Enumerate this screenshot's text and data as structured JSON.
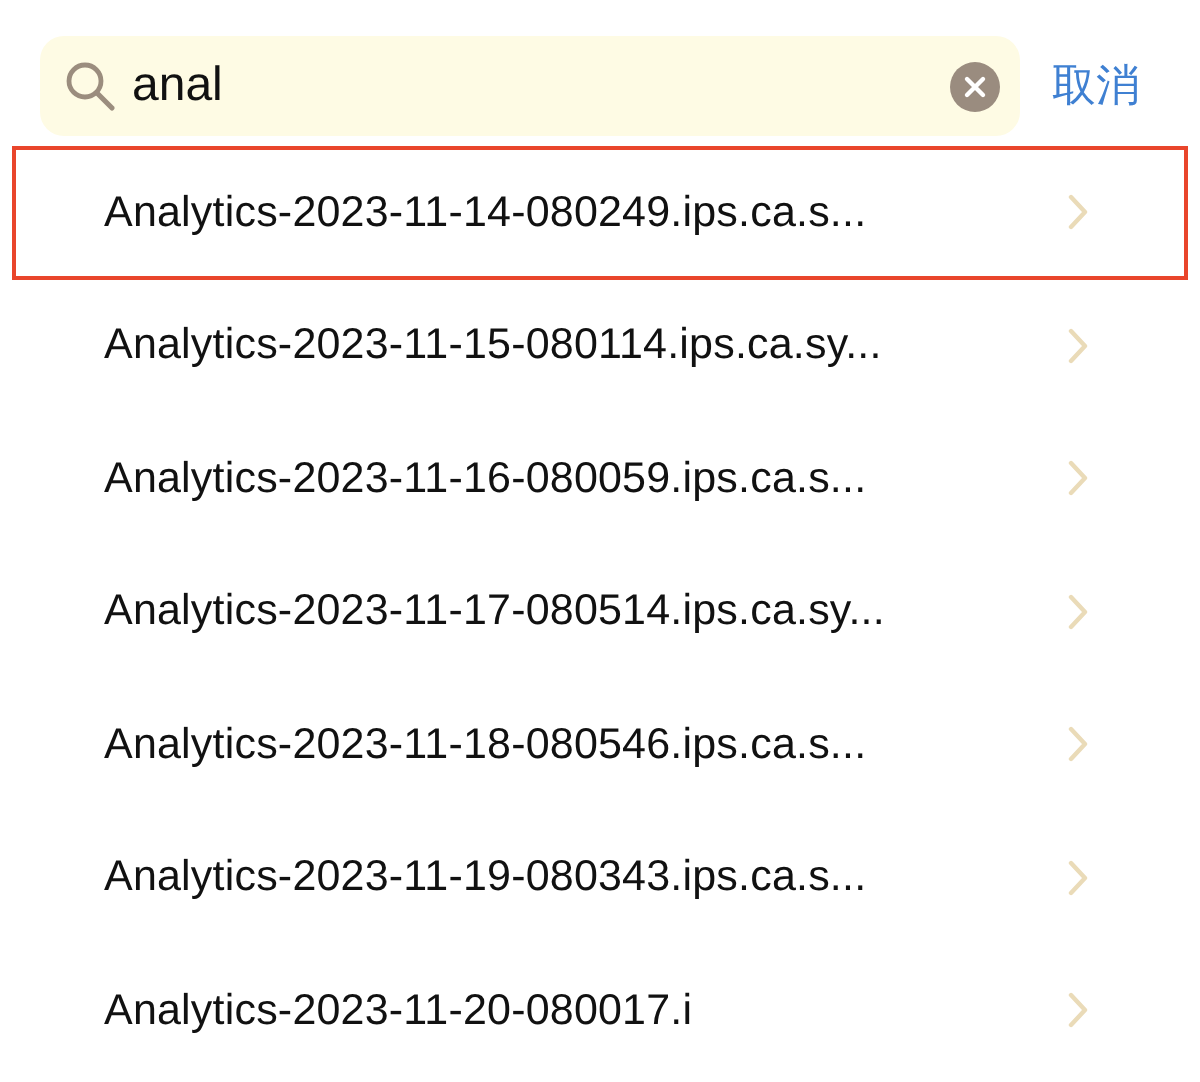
{
  "search": {
    "value": "anal",
    "cancel": "取消"
  },
  "results": [
    {
      "name": "Analytics-2023-11-14-080249.ips.ca.s...",
      "selected": true
    },
    {
      "name": "Analytics-2023-11-15-080114.ips.ca.sy...",
      "selected": false
    },
    {
      "name": "Analytics-2023-11-16-080059.ips.ca.s...",
      "selected": false
    },
    {
      "name": "Analytics-2023-11-17-080514.ips.ca.sy...",
      "selected": false
    },
    {
      "name": "Analytics-2023-11-18-080546.ips.ca.s...",
      "selected": false
    },
    {
      "name": "Analytics-2023-11-19-080343.ips.ca.s...",
      "selected": false
    },
    {
      "name": "Analytics-2023-11-20-080017.i",
      "selected": false
    }
  ]
}
